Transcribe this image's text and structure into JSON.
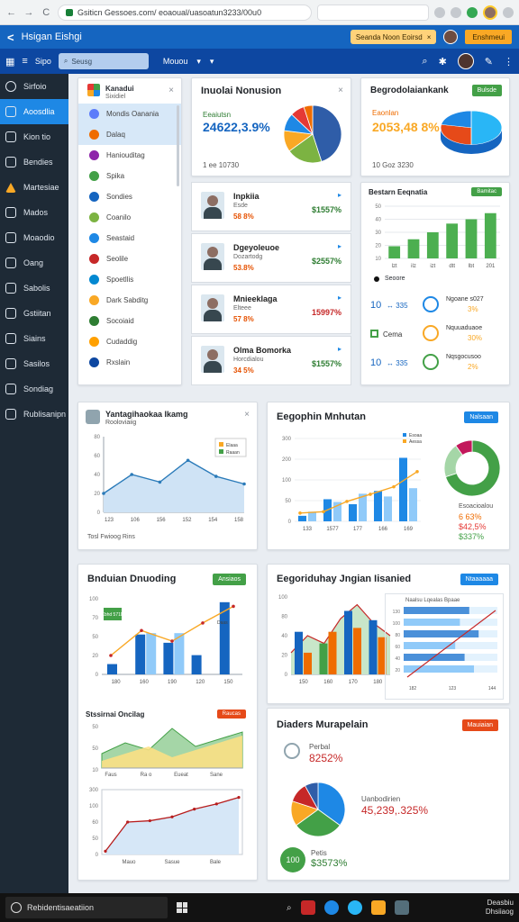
{
  "browser": {
    "url": "Gsiticn Gessoes.com/ eoaoual/uasoatun3233/00u0",
    "back": "←",
    "forward": "→",
    "reload": "C"
  },
  "header": {
    "logo": "<",
    "title": "Hsigan Eishgi",
    "notice": "Seanda Noon Eoirsd",
    "notice_close": "×",
    "cta": "Enshmeui"
  },
  "toolbar": {
    "menu": "Sipo",
    "search_placeholder": "Seusg",
    "select_label": "Mouou",
    "select_caret": "▾",
    "select_caret2": "▾"
  },
  "sidebar": {
    "items": [
      {
        "label": "Sirfoio",
        "icon": "circle-icon"
      },
      {
        "label": "Aoosdlia",
        "icon": "document-icon",
        "active": true
      },
      {
        "label": "Kion tio",
        "icon": "phone-icon"
      },
      {
        "label": "Bendies",
        "icon": "monitor-icon"
      },
      {
        "label": "Martesiae",
        "icon": "warning-icon"
      },
      {
        "label": "Mados",
        "icon": "shield-icon"
      },
      {
        "label": "Moaodio",
        "icon": "gear-icon"
      },
      {
        "label": "Oang",
        "icon": "check-icon"
      },
      {
        "label": "Sabolis",
        "icon": "music-icon"
      },
      {
        "label": "Gstiitan",
        "icon": "play-icon"
      },
      {
        "label": "Siains",
        "icon": "folder-icon"
      },
      {
        "label": "Sasilos",
        "icon": "play-icon"
      },
      {
        "label": "Sondiag",
        "icon": "camera-icon"
      },
      {
        "label": "Rublisanipn",
        "icon": "briefcase-icon"
      }
    ]
  },
  "list_panel": {
    "title": "Kanadui",
    "subtitle": "Sixidiel",
    "close": "×",
    "rows": [
      {
        "label": "Mondis Oanania",
        "color": "#5c7cfa",
        "selected": true
      },
      {
        "label": "Dalaq",
        "color": "#ef6c00",
        "selected": true
      },
      {
        "label": "Haniouditag",
        "color": "#8e24aa"
      },
      {
        "label": "Spika",
        "color": "#43a047"
      },
      {
        "label": "Sondies",
        "color": "#1565c0"
      },
      {
        "label": "Coanilo",
        "color": "#7cb342"
      },
      {
        "label": "Seastaid",
        "color": "#1e88e5"
      },
      {
        "label": "Seolile",
        "color": "#c62828"
      },
      {
        "label": "Spoetllis",
        "color": "#0288d1"
      },
      {
        "label": "Dark Sabditg",
        "color": "#f9a825"
      },
      {
        "label": "Socoiaid",
        "color": "#2e7d32"
      },
      {
        "label": "Cudaddig",
        "color": "#ffa000"
      },
      {
        "label": "Rxslain",
        "color": "#0d47a1"
      }
    ]
  },
  "card_nonusion": {
    "title": "Inuolai Nonusion",
    "close": "×",
    "label": "Eeaiutsn",
    "value": "24622,3.9%",
    "footer": "1 ee 10730",
    "pie": [
      45,
      20,
      12,
      10,
      8,
      5
    ],
    "pie_colors": [
      "#2f5da8",
      "#7cb342",
      "#f9a825",
      "#1e88e5",
      "#e53935",
      "#ef6c00"
    ]
  },
  "card_begrod": {
    "title": "Begrodolaiankank",
    "badge": "Bulsde",
    "label": "Eaonlan",
    "value": "2053,48 8%",
    "footer": "10 Goz 3230",
    "pie": [
      50,
      28,
      22
    ],
    "pie_colors": [
      "#29b6f6",
      "#e64a19",
      "#1e88e5"
    ]
  },
  "people": [
    {
      "name": "Inpkiia",
      "sub": "Esde",
      "pct": "58 8%",
      "amount": "$1557%",
      "arrow": "▸",
      "red": false
    },
    {
      "name": "Dgeyoleuoe",
      "sub": "Dozartodg",
      "pct": "53.8%",
      "amount": "$2557%",
      "arrow": "▸",
      "red": false
    },
    {
      "name": "Mnieeklaga",
      "sub": "Elteee",
      "pct": "57 8%",
      "amount": "15997%",
      "arrow": "▸",
      "red": true
    },
    {
      "name": "Olma Bomorka",
      "sub": "Horcdialou",
      "pct": "34 5%",
      "amount": "$1557%",
      "arrow": "▸",
      "red": false
    }
  ],
  "card_bestarn": {
    "title": "Bestarn Eeqnatia",
    "badge": "Bamitac",
    "legend": "Seoore",
    "chart_data": {
      "type": "bar",
      "categories": [
        "lzt",
        "ilz",
        "izt",
        "dtt",
        "lbt",
        "201"
      ],
      "values": [
        14,
        22,
        30,
        40,
        45,
        52
      ],
      "ylim": [
        0,
        60
      ]
    },
    "tick_labels": [
      "lzt",
      "ilz",
      "izt",
      "dtt",
      "lbt",
      "201"
    ],
    "y_axis_labels": [
      "50",
      "40",
      "30",
      "20",
      "10"
    ],
    "stats": [
      {
        "num": "10",
        "arrows": "↔ 335",
        "icon": "chart-icon",
        "label": "Ngoane s027",
        "pct": "3%"
      },
      {
        "num": "",
        "arrows": "",
        "icon": "window-icon",
        "prefix": "Cema",
        "label": "Nquuaduaoe",
        "pct": "30%"
      },
      {
        "num": "10",
        "arrows": "↔ 335",
        "icon": "leaf-icon",
        "label": "Nqsgocusoo",
        "pct": "2%"
      }
    ]
  },
  "card_yantag": {
    "title": "Yantagihaokaa Ikamg",
    "subtitle": "Rooloviaiig",
    "close": "×",
    "footer": "Tosl Fwioog Rins",
    "legend": [
      "Elaaa",
      "Raaan"
    ],
    "chart_data": {
      "type": "area",
      "x": [
        "123",
        "106",
        "156",
        "152",
        "154",
        "158"
      ],
      "values": [
        20,
        40,
        32,
        55,
        38,
        30
      ],
      "ylim": [
        0,
        80
      ]
    },
    "y_axis_labels": [
      "80",
      "60",
      "40",
      "20",
      "0"
    ]
  },
  "card_eegophin": {
    "title": "Eegophin Mnhutan",
    "badge": "Nalsaan",
    "legend": [
      "Esoaa",
      "Aessa"
    ],
    "chart_data": {
      "type": "bar",
      "categories": [
        "133",
        "1577",
        "177",
        "166",
        "169"
      ],
      "series": [
        {
          "values": [
            20,
            80,
            62,
            110,
            230
          ]
        },
        {
          "values": [
            35,
            70,
            100,
            90,
            120
          ]
        }
      ],
      "line": [
        30,
        35,
        72,
        98,
        125,
        180
      ],
      "ylim": [
        0,
        300
      ]
    },
    "y_axis_labels": [
      "300",
      "200",
      "100",
      "50",
      "0"
    ],
    "donut_label": "Esoacioalou",
    "donut_values": [
      "6 63%",
      "$42,5%",
      "$337%"
    ],
    "donut": [
      70,
      20,
      10
    ],
    "donut_colors": [
      "#43a047",
      "#a5d6a7",
      "#c2185b"
    ]
  },
  "card_bnduian": {
    "title": "Bnduian Dnuoding",
    "badge": "Ansiaos",
    "legend_callout": "Xbhd 571D",
    "chart_data": {
      "type": "bar",
      "categories": [
        "180",
        "160",
        "190",
        "120",
        "150"
      ],
      "series": [
        {
          "values": [
            15,
            58,
            46,
            28,
            105
          ]
        },
        {
          "values": [
            0,
            60,
            60,
            0,
            0
          ]
        }
      ],
      "line": [
        25,
        58,
        44,
        68,
        90
      ],
      "ylim": [
        0,
        100
      ]
    },
    "y_axis_labels": [
      "100",
      "70",
      "50",
      "20",
      "0"
    ],
    "legend": [
      "Daas"
    ],
    "sub_title": "Stssirnai Oncilag",
    "sub_badge": "Raucas",
    "sub_area": {
      "x": [
        "Faus",
        "Ra o",
        "Eueat",
        "Sane"
      ],
      "values": [
        20,
        35,
        25,
        55,
        30,
        40,
        50
      ],
      "values2": [
        10,
        20,
        30,
        15,
        25,
        35,
        45
      ]
    },
    "sub_y": [
      "50",
      "50",
      "10"
    ],
    "sub_line": {
      "x": [
        "Mauo",
        "Sasue",
        "Bale"
      ],
      "values": [
        5,
        50,
        52,
        58,
        70,
        78,
        88
      ],
      "ylim": [
        0,
        100
      ]
    },
    "sub_line_y": [
      "300",
      "100",
      "60",
      "50",
      "0"
    ]
  },
  "card_eegorid": {
    "title": "Eegoriduhay Jngian Iisanied",
    "badge": "Ntaaaaaa",
    "chart_data": {
      "type": "bar",
      "categories": [
        "150",
        "160",
        "170",
        "180"
      ],
      "series": [
        {
          "values": [
            55,
            40,
            82,
            70
          ]
        },
        {
          "values": [
            28,
            55,
            60,
            48
          ]
        }
      ],
      "area": [
        28,
        50,
        40,
        72,
        90,
        66,
        50
      ],
      "ylim": [
        0,
        100
      ]
    },
    "y_axis_labels": [
      "100",
      "80",
      "40",
      "20",
      "0"
    ],
    "hbar_title": "Naalsu Lqealas Bpaae",
    "hbar": [
      70,
      60,
      80,
      55,
      65,
      75
    ],
    "hbar_x": [
      "182",
      "123",
      "144"
    ],
    "hbar_y": [
      "130",
      "100",
      "80",
      "60",
      "40",
      "20"
    ]
  },
  "card_diaders": {
    "title": "Diaders Murapelain",
    "badge": "Mauiaian",
    "stat1_label": "Perbal",
    "stat1_value": "8252%",
    "pie_label": "Uanbodirien",
    "pie_value": "45,239,.325%",
    "pie": [
      35,
      30,
      15,
      12,
      8
    ],
    "pie_colors": [
      "#1e88e5",
      "#43a047",
      "#f9a825",
      "#c62828",
      "#2f5da8"
    ],
    "stat2_badge": "100",
    "stat2_label": "Petis",
    "stat2_value": "$3573%"
  },
  "taskbar": {
    "start_label": "Rebidentisaeatiion",
    "clock_line1": "Deasbiu",
    "clock_line2": "Dhsiiaog"
  }
}
